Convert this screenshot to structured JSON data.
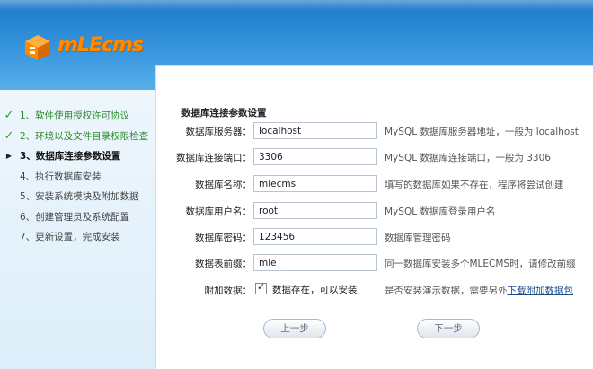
{
  "brand": {
    "logo_text": "mLEcms"
  },
  "steps": [
    {
      "label": "1、软件使用授权许可协议",
      "status": "done"
    },
    {
      "label": "2、环境以及文件目录权限检查",
      "status": "done"
    },
    {
      "label": "3、数据库连接参数设置",
      "status": "current"
    },
    {
      "label": "4、执行数据库安装",
      "status": "pending"
    },
    {
      "label": "5、安装系统模块及附加数据",
      "status": "pending"
    },
    {
      "label": "6、创建管理员及系统配置",
      "status": "pending"
    },
    {
      "label": "7、更新设置，完成安装",
      "status": "pending"
    }
  ],
  "panel": {
    "title": "数据库连接参数设置",
    "fields": [
      {
        "label": "数据库服务器：",
        "value": "localhost",
        "hint": "MySQL 数据库服务器地址，一般为 localhost"
      },
      {
        "label": "数据库连接端口：",
        "value": "3306",
        "hint": "MySQL 数据库连接端口，一般为 3306"
      },
      {
        "label": "数据库名称：",
        "value": "mlecms",
        "hint": "填写的数据库如果不存在，程序将尝试创建"
      },
      {
        "label": "数据库用户名：",
        "value": "root",
        "hint": "MySQL 数据库登录用户名"
      },
      {
        "label": "数据库密码：",
        "value": "123456",
        "hint": "数据库管理密码"
      },
      {
        "label": "数据表前缀：",
        "value": "mle_",
        "hint": "同一数据库安装多个MLECMS时，请修改前缀"
      }
    ],
    "extra": {
      "label": "附加数据：",
      "checkbox_label": "数据存在，可以安装",
      "checked": true,
      "hint": "是否安装演示数据，需要另外",
      "link": "下载附加数据包"
    }
  },
  "buttons": {
    "prev": "上一步",
    "next": "下一步"
  },
  "colors": {
    "header": "#2a88d8",
    "logo": "#ff8a00",
    "done": "#2aa02a"
  }
}
